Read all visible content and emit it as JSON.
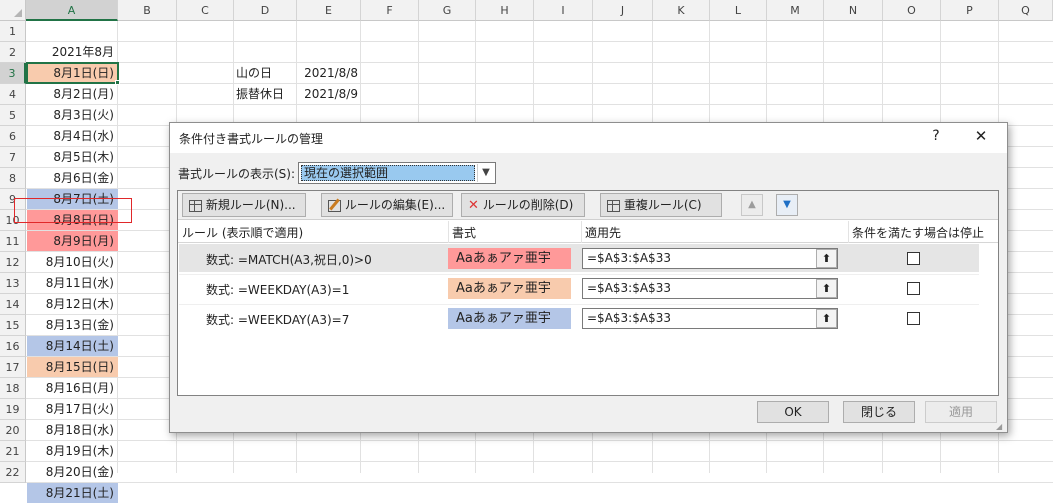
{
  "columns": [
    "A",
    "B",
    "C",
    "D",
    "E",
    "F",
    "G",
    "H",
    "I",
    "J",
    "K",
    "L",
    "M",
    "N",
    "O",
    "P",
    "Q"
  ],
  "rows": [
    "1",
    "2",
    "3",
    "4",
    "5",
    "6",
    "7",
    "8",
    "9",
    "10",
    "11",
    "12",
    "13",
    "14",
    "15",
    "16",
    "17",
    "18",
    "19",
    "20",
    "21",
    "22"
  ],
  "sheet": {
    "a2": "2021年8月",
    "dates": [
      "8月1日(日)",
      "8月2日(月)",
      "8月3日(火)",
      "8月4日(水)",
      "8月5日(木)",
      "8月6日(金)",
      "8月7日(土)",
      "8月8日(日)",
      "8月9日(月)",
      "8月10日(火)",
      "8月11日(水)",
      "8月12日(木)",
      "8月13日(金)",
      "8月14日(土)",
      "8月15日(日)",
      "8月16日(月)",
      "8月17日(火)",
      "8月18日(水)",
      "8月19日(木)",
      "8月20日(金)",
      "8月21日(土)"
    ],
    "holidays": [
      {
        "name": "山の日",
        "date": "2021/8/8"
      },
      {
        "name": "振替休日",
        "date": "2021/8/9"
      }
    ]
  },
  "colors": {
    "sunday": "#f8cbad",
    "saturday": "#b4c6e7",
    "holiday": "#ff9999",
    "selection": "#217346",
    "redbox": "#e0282a",
    "dropdown_highlight": "#99c9ef"
  },
  "dialog": {
    "title": "条件付き書式ルールの管理",
    "help": "?",
    "close": "✕",
    "show_rules_label": "書式ルールの表示(S):",
    "show_rules_value": "現在の選択範囲",
    "toolbar": {
      "new_rule": "新規ルール(N)...",
      "edit_rule": "ルールの編集(E)...",
      "delete_rule": "ルールの削除(D)",
      "duplicate_rule": "重複ルール(C)"
    },
    "headers": {
      "rule": "ルール (表示順で適用)",
      "format": "書式",
      "applies_to": "適用先",
      "stop_if_true": "条件を満たす場合は停止"
    },
    "rules": [
      {
        "rule": "数式: =MATCH(A3,祝日,0)>0",
        "preview": "Aaあぁアァ亜宇",
        "applies_to": "=$A$3:$A$33",
        "stop": false
      },
      {
        "rule": "数式: =WEEKDAY(A3)=1",
        "preview": "Aaあぁアァ亜宇",
        "applies_to": "=$A$3:$A$33",
        "stop": false
      },
      {
        "rule": "数式: =WEEKDAY(A3)=7",
        "preview": "Aaあぁアァ亜宇",
        "applies_to": "=$A$3:$A$33",
        "stop": false
      }
    ],
    "buttons": {
      "ok": "OK",
      "close": "閉じる",
      "apply": "適用"
    }
  }
}
